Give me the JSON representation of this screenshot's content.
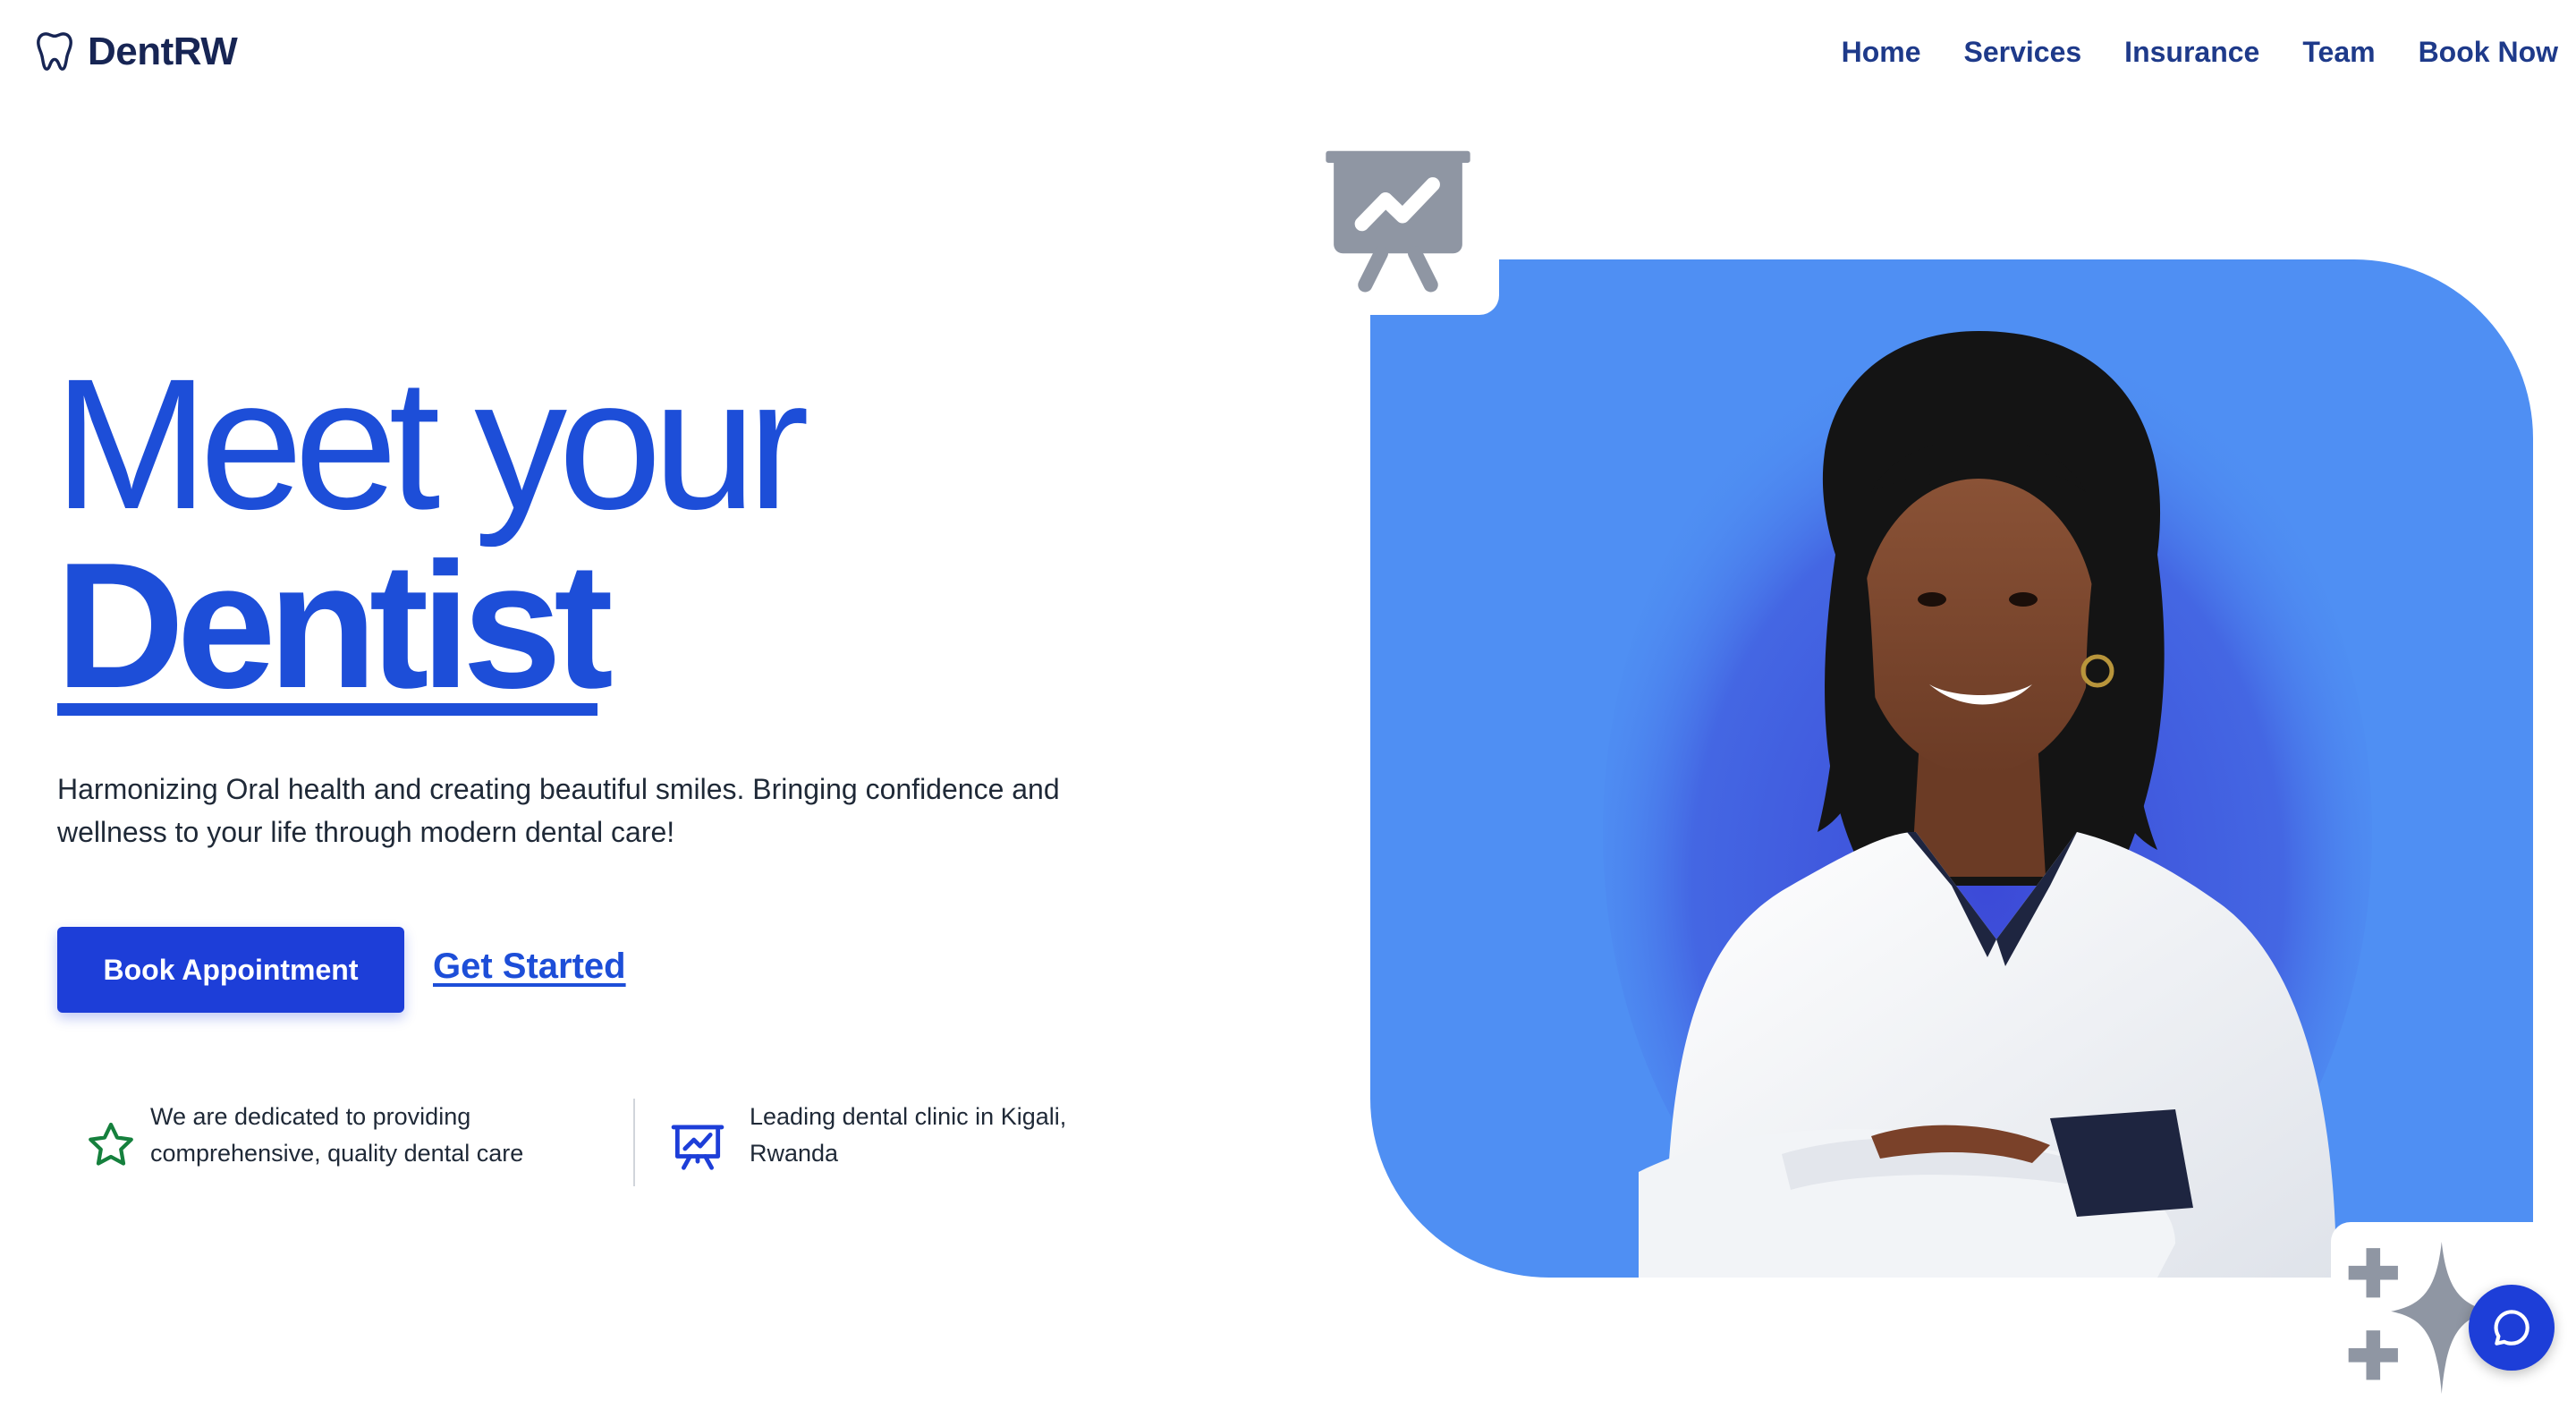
{
  "header": {
    "brand": {
      "name": "DentRW",
      "logo_icon": "tooth-icon"
    },
    "nav": [
      {
        "label": "Home"
      },
      {
        "label": "Services"
      },
      {
        "label": "Insurance"
      },
      {
        "label": "Team"
      },
      {
        "label": "Book Now"
      }
    ]
  },
  "hero": {
    "title_line_1": "Meet your",
    "title_line_2": "Dentist",
    "subtitle": "Harmonizing Oral health and creating beautiful smiles. Bringing confidence and wellness to your life through modern dental care!",
    "primary_button": "Book Appointment",
    "secondary_link": "Get Started",
    "features": [
      {
        "icon": "star-icon",
        "text": "We are dedicated to providing comprehensive, quality dental care"
      },
      {
        "icon": "presentation-chart-icon",
        "text": "Leading dental clinic in Kigali, Rwanda"
      }
    ],
    "image": {
      "description_icon": "dentist-portrait",
      "decorative_top_icon": "presentation-chart-icon",
      "decorative_bottom_icon": "sparkles-icon"
    }
  },
  "chat": {
    "icon": "chat-bubble-icon"
  },
  "colors": {
    "brand_dark": "#172554",
    "nav": "#1e3a8a",
    "primary": "#1d4ed8",
    "button": "#1d3ed8",
    "panel": "#4f8ff3",
    "feature_star": "#15803d",
    "deco_gray": "#8f96a3"
  }
}
